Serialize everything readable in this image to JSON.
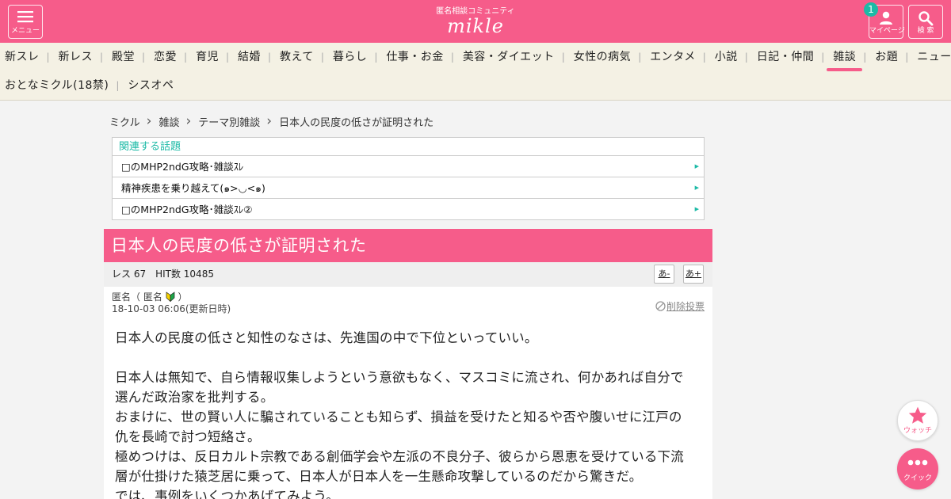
{
  "header": {
    "menu_label": "メニュー",
    "logo_sub": "匿名相談コミュニティ",
    "logo": "mikle",
    "mypage_label": "マイページ",
    "mypage_badge": "1",
    "search_label": "検 索",
    "accent_color": "#f65c8a"
  },
  "nav": {
    "row1": [
      "新スレ",
      "新レス",
      "殿堂",
      "恋愛",
      "育児",
      "結婚",
      "教えて",
      "暮らし",
      "仕事・お金",
      "美容・ダイエット",
      "女性の病気",
      "エンタメ",
      "小説",
      "日記・仲間",
      "雑談",
      "お題",
      "ニュース"
    ],
    "row2": [
      "おとなミクル(18禁)",
      "シスオペ"
    ],
    "active": "雑談"
  },
  "breadcrumb": [
    "ミクル",
    "雑談",
    "テーマ別雑談",
    "日本人の民度の低さが証明された"
  ],
  "related": {
    "title": "関連する話題",
    "items": [
      "□のMHP2ndG攻略･雑談ｽﾚ",
      "精神疾患を乗り越えて(๑>◡<๑)",
      "□のMHP2ndG攻略･雑談ｽﾚ②"
    ]
  },
  "thread": {
    "title": "日本人の民度の低さが証明された",
    "stats": "レス 67　HIT数 10485",
    "font_smaller": "あ-",
    "font_larger": "あ+"
  },
  "post": {
    "poster": "匿名（ 匿名",
    "poster_close": "）",
    "date": "18-10-03 06:06(更新日時)",
    "delete_vote": "削除投票",
    "lines": [
      "日本人の民度の低さと知性のなさは、先進国の中で下位といっていい。",
      "",
      "日本人は無知で、自ら情報収集しようという意欲もなく、マスコミに流され、何かあれば自分で",
      "選んだ政治家を批判する。",
      "おまけに、世の賢い人に騙されていることも知らず、損益を受けたと知るや否や腹いせに江戸の",
      "仇を長崎で討つ短絡さ。",
      "極めつけは、反日カルト宗教である創価学会や左派の不良分子、彼らから恩恵を受けている下流",
      "層が仕掛けた猿芝居に乗って、日本人が日本人を一生懸命攻撃しているのだから驚きだ。",
      "では、事例をいくつかあげてみよう。"
    ]
  },
  "fab": {
    "watch_label": "ウォッチ",
    "quick_label": "クイック"
  }
}
